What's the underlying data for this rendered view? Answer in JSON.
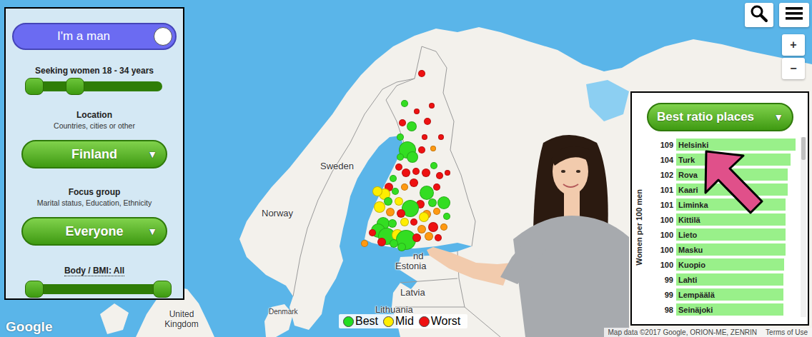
{
  "map": {
    "labels": [
      "Sweden",
      "Norway",
      "Estonia",
      "nd",
      "Latvia",
      "Lithuania",
      "Denmark",
      "United Kingdom"
    ],
    "logo": "Google",
    "attribution": "Map data ©2017 Google, ORION-ME, ZENRIN",
    "terms": "Terms of Use",
    "dots": [
      {
        "color": "#ee1111"
      },
      {
        "color": "#33dd22"
      },
      {
        "color": "#ee1111"
      },
      {
        "color": "#ee1111"
      },
      {
        "color": "#ee1111"
      },
      {
        "color": "#ee1111"
      },
      {
        "color": "#33dd22"
      },
      {
        "color": "#ee1111"
      },
      {
        "color": "#ee1111"
      },
      {
        "color": "#33dd22"
      },
      {
        "color": "#ff9911"
      },
      {
        "color": "#33dd22"
      },
      {
        "color": "#33dd22"
      },
      {
        "color": "#33dd22"
      },
      {
        "color": "#ee1111"
      },
      {
        "color": "#ee1111"
      },
      {
        "color": "#ee1111"
      },
      {
        "color": "#ee1111"
      },
      {
        "color": "#ee1111"
      },
      {
        "color": "#33dd22"
      },
      {
        "color": "#ee1111"
      },
      {
        "color": "#ee1111"
      },
      {
        "color": "#33dd22"
      },
      {
        "color": "#ee1111"
      },
      {
        "color": "#ffee00"
      },
      {
        "color": "#33dd22"
      },
      {
        "color": "#ff9911"
      },
      {
        "color": "#ee1111"
      },
      {
        "color": "#33dd22"
      },
      {
        "color": "#ee1111"
      },
      {
        "color": "#33dd22"
      },
      {
        "color": "#33dd22"
      },
      {
        "color": "#ee1111"
      },
      {
        "color": "#33dd22"
      },
      {
        "color": "#ffee00"
      },
      {
        "color": "#33dd22"
      },
      {
        "color": "#ffee00"
      },
      {
        "color": "#ffee00"
      },
      {
        "color": "#ff9911"
      },
      {
        "color": "#ee1111"
      },
      {
        "color": "#ff9911"
      },
      {
        "color": "#ff9911"
      },
      {
        "color": "#33dd22"
      },
      {
        "color": "#ffee00"
      },
      {
        "color": "#33dd22"
      },
      {
        "color": "#33dd22"
      },
      {
        "color": "#ffee00"
      },
      {
        "color": "#ee1111"
      },
      {
        "color": "#ff9911"
      },
      {
        "color": "#ee1111"
      },
      {
        "color": "#ff9911"
      },
      {
        "color": "#33dd22"
      },
      {
        "color": "#33dd22"
      },
      {
        "color": "#ffee00"
      },
      {
        "color": "#33dd22"
      },
      {
        "color": "#ee1111"
      },
      {
        "color": "#ff9911"
      },
      {
        "color": "#ee1111"
      },
      {
        "color": "#33dd22"
      },
      {
        "color": "#ee1111"
      },
      {
        "color": "#33dd22"
      },
      {
        "color": "#ff9911"
      },
      {
        "color": "#ee1111"
      }
    ]
  },
  "zoom": {
    "in": "+",
    "out": "−"
  },
  "filters": {
    "gender_toggle": {
      "label": "I'm a man",
      "on": true
    },
    "age": {
      "label": "Seeking women 18 - 34 years",
      "low": 0.06,
      "high": 0.36
    },
    "location": {
      "title": "Location",
      "hint": "Countries, cities or other",
      "value": "Finland",
      "icon": "▼"
    },
    "focus": {
      "title": "Focus group",
      "hint": "Marital status, Education, Ethnicity",
      "value": "Everyone",
      "icon": "▼"
    },
    "body": {
      "label": "Body / BMI: All",
      "low": 0.06,
      "high": 1.0
    }
  },
  "ranking": {
    "title": "Best ratio places",
    "icon": "▼",
    "axis_label": "Women per 100 men",
    "rows": [
      {
        "value": "109",
        "name": "Helsinki",
        "level": 0.98
      },
      {
        "value": "104",
        "name": "Turk",
        "level": 0.94
      },
      {
        "value": "102",
        "name": "Rova",
        "level": 0.92
      },
      {
        "value": "101",
        "name": "Kaari",
        "level": 0.92
      },
      {
        "value": "101",
        "name": "Liminka",
        "level": 0.9
      },
      {
        "value": "100",
        "name": "Kittilä",
        "level": 0.9
      },
      {
        "value": "100",
        "name": "Lieto",
        "level": 0.9
      },
      {
        "value": "100",
        "name": "Masku",
        "level": 0.9
      },
      {
        "value": "100",
        "name": "Kuopio",
        "level": 0.89
      },
      {
        "value": "99",
        "name": "Lahti",
        "level": 0.88
      },
      {
        "value": "99",
        "name": "Lempäälä",
        "level": 0.88
      },
      {
        "value": "98",
        "name": "Seinäjoki",
        "level": 0.88
      }
    ]
  },
  "legend": [
    {
      "label": "Best",
      "color": "#22dd22"
    },
    {
      "label": "Mid",
      "color": "#ffee00"
    },
    {
      "label": "Worst",
      "color": "#ee1111"
    }
  ]
}
